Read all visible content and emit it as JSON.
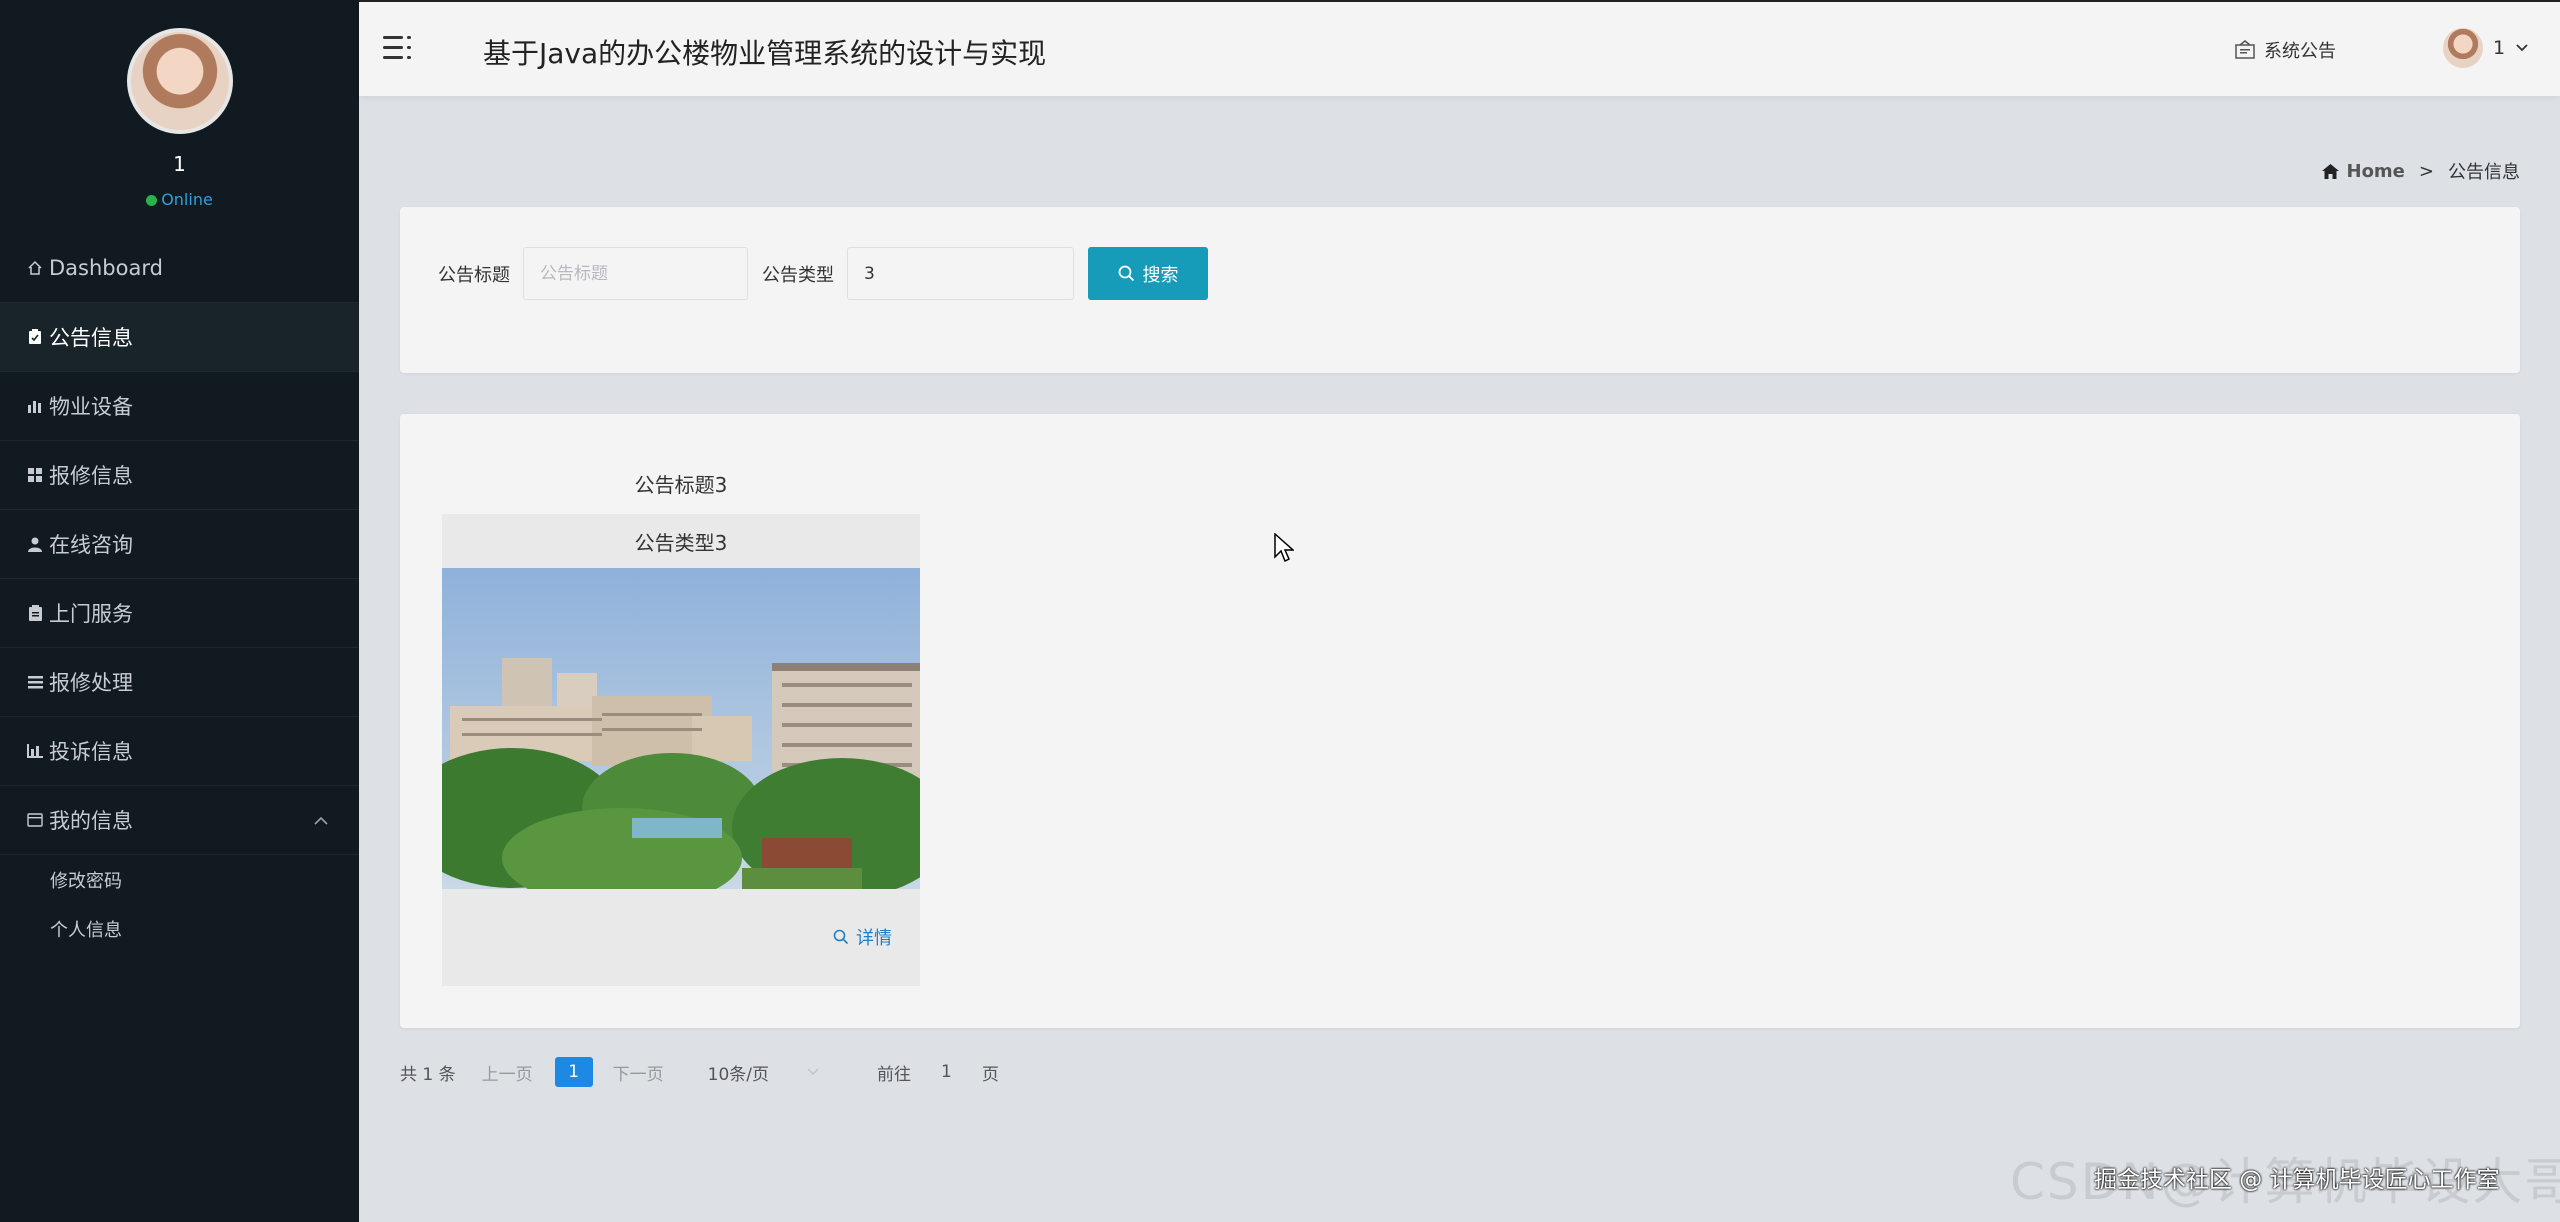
{
  "app": {
    "title": "基于Java的办公楼物业管理系统的设计与实现"
  },
  "sidebar": {
    "user": {
      "name": "1",
      "status": "Online"
    },
    "items": [
      {
        "label": "Dashboard",
        "icon": "home-icon"
      },
      {
        "label": "公告信息",
        "icon": "notice-icon",
        "active": true
      },
      {
        "label": "物业设备",
        "icon": "bar-chart-icon"
      },
      {
        "label": "报修信息",
        "icon": "grid-icon"
      },
      {
        "label": "在线咨询",
        "icon": "user-icon"
      },
      {
        "label": "上门服务",
        "icon": "clipboard-icon"
      },
      {
        "label": "报修处理",
        "icon": "list-icon"
      },
      {
        "label": "投诉信息",
        "icon": "chart-icon"
      },
      {
        "label": "我的信息",
        "icon": "card-icon",
        "expanded": true
      }
    ],
    "sub_items": [
      {
        "label": "修改密码"
      },
      {
        "label": "个人信息"
      }
    ]
  },
  "header": {
    "notice_label": "系统公告",
    "user_label": "1"
  },
  "breadcrumb": {
    "home": "Home",
    "separator": ">",
    "current": "公告信息"
  },
  "search": {
    "title_label": "公告标题",
    "title_placeholder": "公告标题",
    "title_value": "",
    "type_label": "公告类型",
    "type_value": "3",
    "button_label": "搜索"
  },
  "cards": [
    {
      "title": "公告标题3",
      "type": "公告类型3",
      "detail_label": "详情"
    }
  ],
  "pagination": {
    "total": "共 1 条",
    "prev": "上一页",
    "current_page": "1",
    "next": "下一页",
    "page_size": "10条/页",
    "goto_label": "前往",
    "goto_value": "1",
    "page_suffix": "页"
  },
  "watermark": {
    "background": "CSDN@计算机毕设大哥",
    "foreground": "掘金技术社区 @ 计算机毕设匠心工作室"
  },
  "colors": {
    "sidebar_bg": "#111a20",
    "accent": "#169bb8",
    "page_active": "#1e88e5",
    "online": "#2ab24a",
    "link": "#1f7fc4"
  }
}
